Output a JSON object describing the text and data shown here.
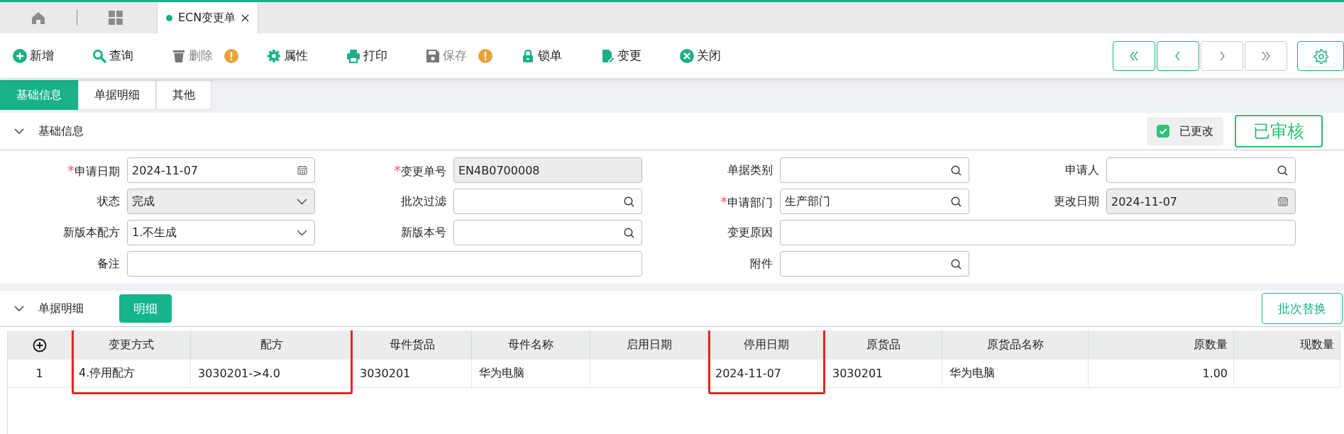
{
  "page_tabs": [
    {
      "kind": "home",
      "selected": false
    },
    {
      "kind": "grid",
      "selected": false
    },
    {
      "kind": "page",
      "label": "ECN变更单",
      "selected": true
    }
  ],
  "toolbar": [
    {
      "kind": "plus",
      "label": "新增",
      "disabled": false,
      "warning": false
    },
    {
      "kind": "search",
      "label": "查询",
      "disabled": false,
      "warning": false
    },
    {
      "kind": "trash",
      "label": "删除",
      "disabled": true,
      "warning": true
    },
    {
      "kind": "gear",
      "label": "属性",
      "disabled": false,
      "warning": false
    },
    {
      "kind": "print",
      "label": "打印",
      "disabled": false,
      "warning": false
    },
    {
      "kind": "save",
      "label": "保存",
      "disabled": true,
      "warning": true
    },
    {
      "kind": "lock",
      "label": "锁单",
      "disabled": false,
      "warning": false
    },
    {
      "kind": "edit",
      "label": "变更",
      "disabled": false,
      "warning": false
    },
    {
      "kind": "close",
      "label": "关闭",
      "disabled": false,
      "warning": false
    }
  ],
  "nav_buttons": [
    {
      "kind": "first",
      "disabled": false
    },
    {
      "kind": "prev",
      "disabled": false
    },
    {
      "kind": "next",
      "disabled": true
    },
    {
      "kind": "last",
      "disabled": true
    }
  ],
  "section_tabs": [
    {
      "label": "基础信息",
      "selected": true
    },
    {
      "label": "单据明细",
      "selected": false
    },
    {
      "label": "其他",
      "selected": false
    }
  ],
  "basic_section": {
    "title": "基础信息",
    "expanded": true,
    "modified": {
      "label": "已更改",
      "checked": true
    },
    "status_stamp": "已审核",
    "fields": [
      {
        "label": "申请日期",
        "required_mark": "*",
        "kind": "date",
        "value": "2024-11-07",
        "readonly": false,
        "wide": false
      },
      {
        "label": "变更单号",
        "required_mark": "*",
        "kind": "text",
        "value": "EN4B0700008",
        "readonly": true,
        "wide": false
      },
      {
        "label": "单据类别",
        "kind": "lookup",
        "readonly": false,
        "wide": false
      },
      {
        "label": "申请人",
        "kind": "lookup",
        "readonly": false,
        "wide": false
      },
      {
        "label": "状态",
        "kind": "select",
        "value": "完成",
        "readonly": true,
        "wide": false
      },
      {
        "label": "批次过滤",
        "kind": "lookup",
        "readonly": false,
        "wide": false
      },
      {
        "label": "申请部门",
        "required_mark": "*",
        "kind": "lookup",
        "value": "生产部门",
        "readonly": false,
        "wide": false
      },
      {
        "label": "更改日期",
        "kind": "date",
        "value": "2024-11-07",
        "readonly": true,
        "wide": false
      },
      {
        "label": "新版本配方",
        "kind": "select",
        "value": "1.不生成",
        "readonly": false,
        "wide": false
      },
      {
        "label": "新版本号",
        "kind": "lookup",
        "readonly": false,
        "wide": false
      },
      {
        "label": "变更原因",
        "kind": "text",
        "readonly": false,
        "wide": true
      },
      {
        "label": "备注",
        "kind": "text",
        "readonly": false,
        "wide": true
      },
      {
        "label": "附件",
        "kind": "lookup",
        "readonly": false,
        "wide": false
      }
    ]
  },
  "detail_section": {
    "title": "单据明细",
    "expanded": true,
    "tab_button": "明细",
    "action_button": "批次替换",
    "table": {
      "columns": [
        {
          "kind": "add",
          "highlighted": false,
          "numeric": false
        },
        {
          "label": "变更方式",
          "kind": "text",
          "highlighted": true,
          "numeric": false
        },
        {
          "label": "配方",
          "kind": "text",
          "highlighted": true,
          "numeric": false
        },
        {
          "label": "母件货品",
          "kind": "text",
          "highlighted": false,
          "numeric": false
        },
        {
          "label": "母件名称",
          "kind": "text",
          "highlighted": false,
          "numeric": false
        },
        {
          "label": "启用日期",
          "kind": "text",
          "highlighted": false,
          "numeric": false
        },
        {
          "label": "停用日期",
          "kind": "text",
          "highlighted": true,
          "numeric": false
        },
        {
          "label": "原货品",
          "kind": "text",
          "highlighted": false,
          "numeric": false
        },
        {
          "label": "原货品名称",
          "kind": "text",
          "highlighted": false,
          "numeric": false
        },
        {
          "label": "原数量",
          "kind": "text",
          "highlighted": false,
          "numeric": true
        },
        {
          "label": "现数量",
          "kind": "text",
          "highlighted": false,
          "numeric": true
        }
      ],
      "rows": [
        {
          "cells": [
            "1",
            "4.停用配方",
            "3030201->4.0",
            "3030201",
            "华为电脑",
            "",
            "2024-11-07",
            "3030201",
            "华为电脑",
            "1.00",
            ""
          ]
        }
      ]
    }
  }
}
